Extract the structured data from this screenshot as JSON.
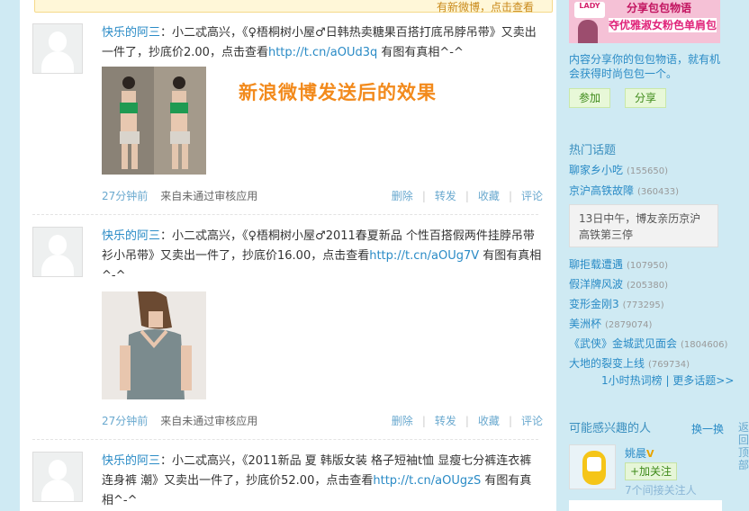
{
  "notice": "有新微博，点击查看",
  "overlay_text": "新浪微博发送后的效果",
  "posts": [
    {
      "user": "快乐的阿三",
      "content": "：小二忒高兴，《♀梧桐树小屋♂日韩热卖糖果百搭打底吊脖吊带》又卖出一件了，抄底价2.00，点击查看",
      "link": "http://t.cn/aOUd3q",
      "suffix": " 有图有真相^-^",
      "time": "27分钟前",
      "source": "来自未通过审核应用",
      "actions": [
        "删除",
        "转发",
        "收藏",
        "评论"
      ]
    },
    {
      "user": "快乐的阿三",
      "content": "：小二忒高兴，《♀梧桐树小屋♂2011春夏新品 个性百搭假两件挂脖吊带衫小吊带》又卖出一件了，抄底价16.00，点击查看",
      "link": "http://t.cn/aOUg7V",
      "suffix": " 有图有真相^-^",
      "time": "27分钟前",
      "source": "来自未通过审核应用",
      "actions": [
        "删除",
        "转发",
        "收藏",
        "评论"
      ]
    },
    {
      "user": "快乐的阿三",
      "content": "：小二忒高兴，《2011新品 夏 韩版女装 格子短袖t恤 显瘦七分裤连衣裤连身裤 潮》又卖出一件了，抄底价52.00，点击查看",
      "link": "http://t.cn/aOUgzS",
      "suffix": " 有图有真相^-^"
    }
  ],
  "sidebar": {
    "ad_badge": "LADY",
    "ad_top": "分享包包物语",
    "ad_line": "夺优雅淑女粉色单肩包",
    "promo": "内容分享你的包包物语，就有机会获得时尚包包一个。",
    "join_label": "参加",
    "share_label": "分享",
    "hot_title": "热门话题",
    "topics": [
      {
        "name": "聊家乡小吃",
        "count": "(155650)"
      },
      {
        "name": "京沪高铁故障",
        "count": "(360433)"
      },
      {
        "name": "聊拒载遭遇",
        "count": "(107950)"
      },
      {
        "name": "假洋牌风波",
        "count": "(205380)"
      },
      {
        "name": "变形金刚3",
        "count": "(773295)"
      },
      {
        "name": "美洲杯",
        "count": "(2879074)"
      },
      {
        "name": "《武侠》金城武见面会",
        "count": "(1804606)"
      },
      {
        "name": "大地的裂变上线",
        "count": "(769734)"
      }
    ],
    "topic_card": "13日中午，博友亲历京沪高铁第三停",
    "more": "1小时热词榜 | 更多话题>>",
    "interest_title": "可能感兴趣的人",
    "swap_label": "换一换",
    "user_name": "姚晨",
    "vip_mark": "V",
    "follow_label": "+加关注",
    "mutual": "7个间接关注人"
  },
  "rail_text": "返回顶部"
}
